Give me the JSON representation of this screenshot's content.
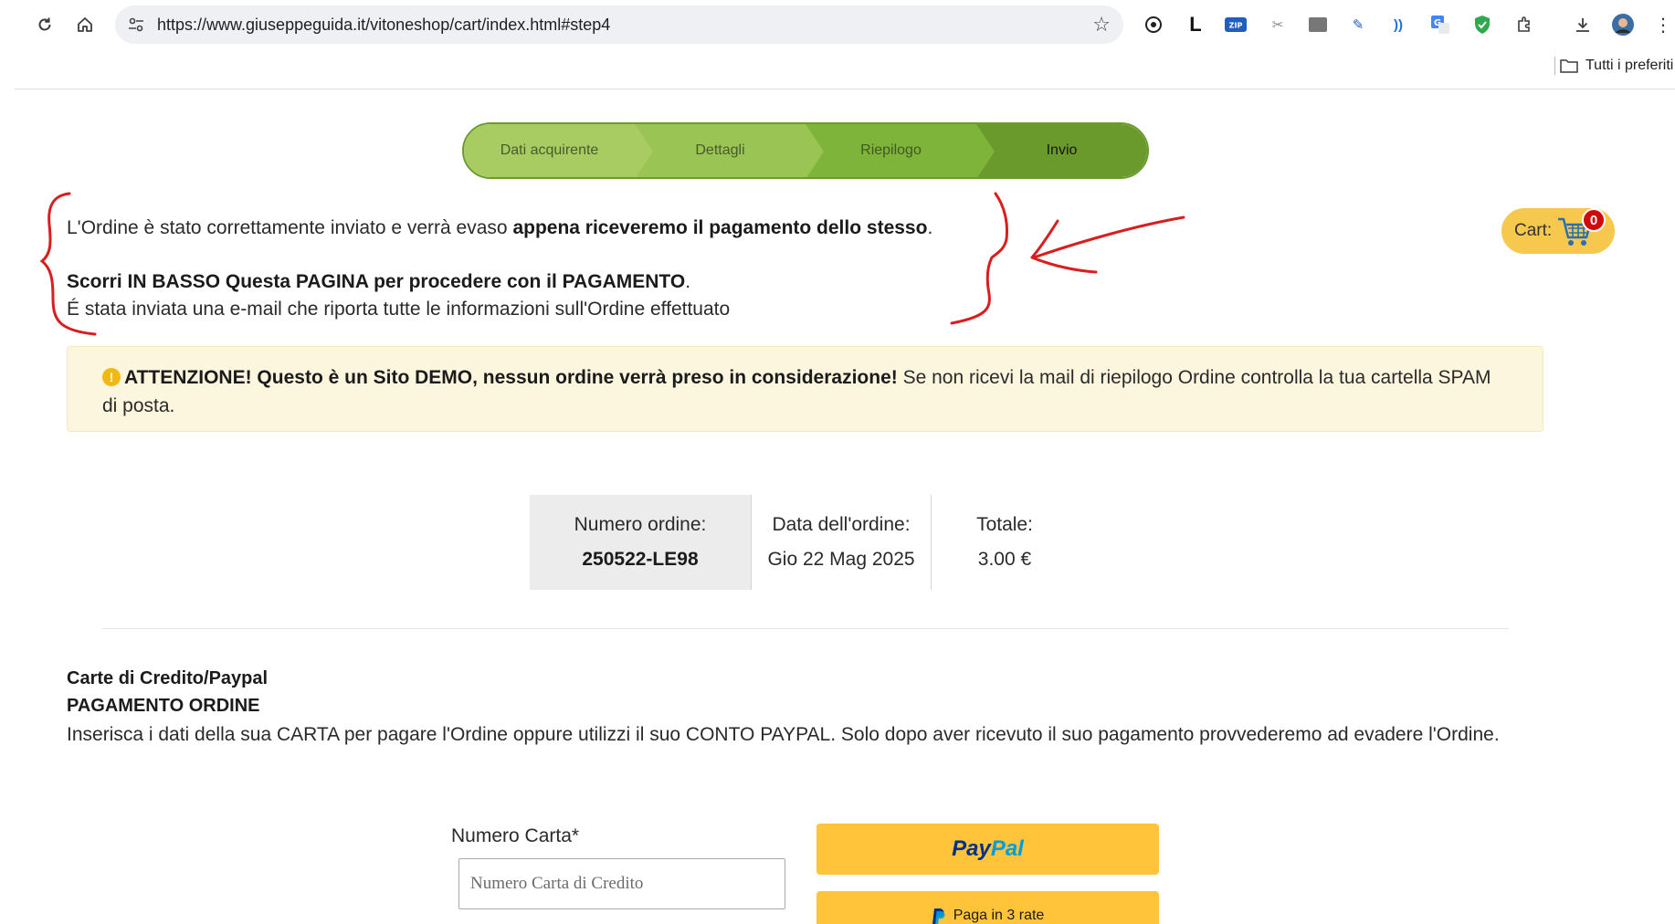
{
  "browser": {
    "url": "https://www.giuseppeguida.it/vitoneshop/cart/index.html#step4",
    "bookmarks_folder_label": "Tutti i preferiti"
  },
  "stepper": {
    "steps": [
      {
        "label": "Dati acquirente"
      },
      {
        "label": "Dettagli"
      },
      {
        "label": "Riepilogo"
      },
      {
        "label": "Invio"
      }
    ],
    "active_index": 3
  },
  "cart": {
    "label": "Cart:",
    "count": "0"
  },
  "confirmation": {
    "line1_text": "L'Ordine è stato correttamente inviato e verrà evaso ",
    "line1_bold": "appena riceveremo il pagamento dello stesso",
    "line1_end": ".",
    "line2_bold": "Scorri IN BASSO Questa PAGINA per procedere con il PAGAMENTO",
    "line2_end": ".",
    "line3": "É stata inviata una e-mail che riporta tutte le informazioni sull'Ordine effettuato"
  },
  "alert": {
    "bold": "ATTENZIONE! Questo è un Sito DEMO, nessun ordine verrà preso in considerazione!",
    "text": " Se non ricevi la mail di riepilogo Ordine controlla la tua cartella SPAM di posta."
  },
  "order": {
    "number_label": "Numero ordine:",
    "number_value": "250522-LE98",
    "date_label": "Data dell'ordine:",
    "date_value": "Gio 22 Mag 2025",
    "total_label": "Totale:",
    "total_value": "3.00 €"
  },
  "payment": {
    "title": "Carte di Credito/Paypal",
    "subtitle": "PAGAMENTO ORDINE",
    "description": "Inserisca i dati della sua CARTA per pagare l'Ordine oppure utilizzi il suo CONTO PAYPAL. Solo dopo aver ricevuto il suo pagamento provvederemo ad evadere l'Ordine.",
    "card_label": "Numero Carta*",
    "card_placeholder": "Numero Carta di Credito",
    "paypal_part1": "Pay",
    "paypal_part2": "Pal",
    "paylater_label": "Paga in 3 rate"
  },
  "colors": {
    "accent_green": "#7fb43a",
    "cart_yellow": "#f6c94e",
    "paypal_yellow": "#ffc439",
    "alert_bg": "#fdf6de",
    "annotation_red": "#d81e1e"
  }
}
